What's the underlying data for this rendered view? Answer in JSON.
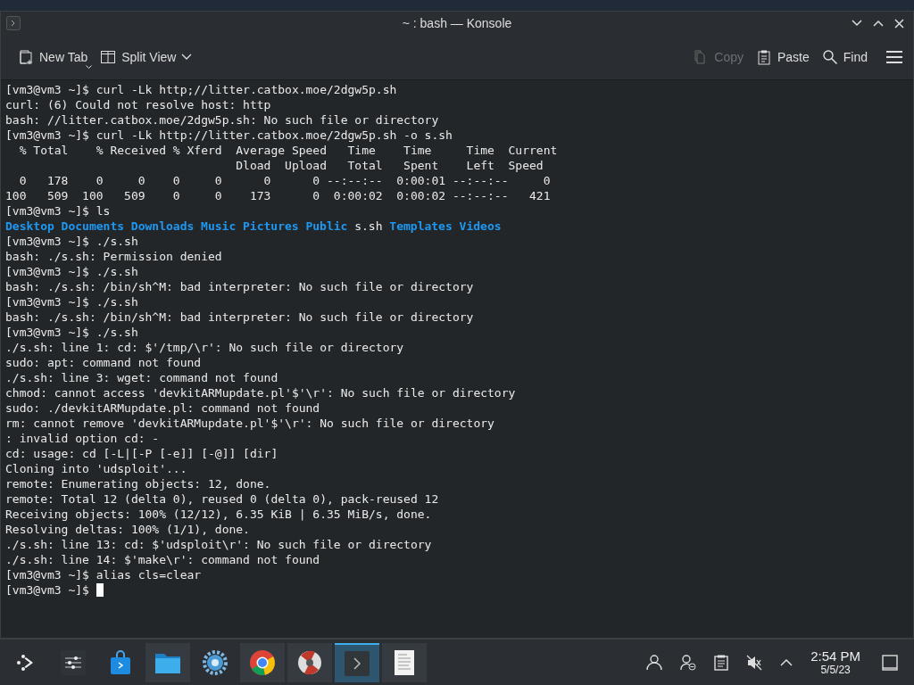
{
  "window": {
    "title": "~ : bash — Konsole"
  },
  "toolbar": {
    "left": [
      {
        "kind": "new-tab",
        "label": "New Tab",
        "disabled": false
      },
      {
        "kind": "split-view",
        "label": "Split View",
        "disabled": false
      }
    ],
    "right": [
      {
        "kind": "copy",
        "label": "Copy",
        "disabled": true
      },
      {
        "kind": "paste",
        "label": "Paste",
        "disabled": false
      },
      {
        "kind": "find",
        "label": "Find",
        "disabled": false
      }
    ]
  },
  "terminal": {
    "lines": [
      {
        "kind": "text",
        "text": "[vm3@vm3 ~]$ curl -Lk http;//litter.catbox.moe/2dgw5p.sh"
      },
      {
        "kind": "text",
        "text": "curl: (6) Could not resolve host: http"
      },
      {
        "kind": "text",
        "text": "bash: //litter.catbox.moe/2dgw5p.sh: No such file or directory"
      },
      {
        "kind": "text",
        "text": "[vm3@vm3 ~]$ curl -Lk http://litter.catbox.moe/2dgw5p.sh -o s.sh"
      },
      {
        "kind": "text",
        "text": "  % Total    % Received % Xferd  Average Speed   Time    Time     Time  Current"
      },
      {
        "kind": "text",
        "text": "                                 Dload  Upload   Total   Spent    Left  Speed"
      },
      {
        "kind": "text",
        "text": "  0   178    0     0    0     0      0      0 --:--:--  0:00:01 --:--:--     0"
      },
      {
        "kind": "text",
        "text": "100   509  100   509    0     0    173      0  0:00:02  0:00:02 --:--:--   421"
      },
      {
        "kind": "text",
        "text": "[vm3@vm3 ~]$ ls"
      },
      {
        "kind": "listing",
        "entries": [
          {
            "name": "Desktop",
            "directory": true
          },
          {
            "name": "Documents",
            "directory": true
          },
          {
            "name": "Downloads",
            "directory": true
          },
          {
            "name": "Music",
            "directory": true
          },
          {
            "name": "Pictures",
            "directory": true
          },
          {
            "name": "Public",
            "directory": true
          },
          {
            "name": "s.sh",
            "directory": false
          },
          {
            "name": "Templates",
            "directory": true
          },
          {
            "name": "Videos",
            "directory": true
          }
        ]
      },
      {
        "kind": "text",
        "text": "[vm3@vm3 ~]$ ./s.sh"
      },
      {
        "kind": "text",
        "text": "bash: ./s.sh: Permission denied"
      },
      {
        "kind": "text",
        "text": "[vm3@vm3 ~]$ ./s.sh"
      },
      {
        "kind": "text",
        "text": "bash: ./s.sh: /bin/sh^M: bad interpreter: No such file or directory"
      },
      {
        "kind": "text",
        "text": "[vm3@vm3 ~]$ ./s.sh"
      },
      {
        "kind": "text",
        "text": "bash: ./s.sh: /bin/sh^M: bad interpreter: No such file or directory"
      },
      {
        "kind": "text",
        "text": "[vm3@vm3 ~]$ ./s.sh"
      },
      {
        "kind": "text",
        "text": "./s.sh: line 1: cd: $'/tmp/\\r': No such file or directory"
      },
      {
        "kind": "text",
        "text": "sudo: apt: command not found"
      },
      {
        "kind": "text",
        "text": "./s.sh: line 3: wget: command not found"
      },
      {
        "kind": "text",
        "text": "chmod: cannot access 'devkitARMupdate.pl'$'\\r': No such file or directory"
      },
      {
        "kind": "text",
        "text": "sudo: ./devkitARMupdate.pl: command not found"
      },
      {
        "kind": "text",
        "text": "rm: cannot remove 'devkitARMupdate.pl'$'\\r': No such file or directory"
      },
      {
        "kind": "text",
        "text": ": invalid option cd: -"
      },
      {
        "kind": "text",
        "text": "cd: usage: cd [-L|[-P [-e]] [-@]] [dir]"
      },
      {
        "kind": "text",
        "text": "Cloning into 'udsploit'..."
      },
      {
        "kind": "text",
        "text": "remote: Enumerating objects: 12, done."
      },
      {
        "kind": "text",
        "text": "remote: Total 12 (delta 0), reused 0 (delta 0), pack-reused 12"
      },
      {
        "kind": "text",
        "text": "Receiving objects: 100% (12/12), 6.35 KiB | 6.35 MiB/s, done."
      },
      {
        "kind": "text",
        "text": "Resolving deltas: 100% (1/1), done."
      },
      {
        "kind": "text",
        "text": "./s.sh: line 13: cd: $'udsploit\\r': No such file or directory"
      },
      {
        "kind": "text",
        "text": "./s.sh: line 14: $'make\\r': command not found"
      },
      {
        "kind": "text",
        "text": "[vm3@vm3 ~]$ alias cls=clear"
      },
      {
        "kind": "prompt",
        "text": "[vm3@vm3 ~]$ "
      }
    ]
  },
  "taskbar": {
    "apps": [
      {
        "kind": "launcher",
        "running": false,
        "active": false
      },
      {
        "kind": "sliders",
        "running": false,
        "active": false
      },
      {
        "kind": "store",
        "running": false,
        "active": false
      },
      {
        "kind": "folder",
        "running": true,
        "active": false
      },
      {
        "kind": "gear",
        "running": false,
        "active": false
      },
      {
        "kind": "browser",
        "running": true,
        "active": false
      },
      {
        "kind": "disc",
        "running": true,
        "active": false
      },
      {
        "kind": "terminal",
        "running": true,
        "active": true
      },
      {
        "kind": "document",
        "running": true,
        "active": false
      }
    ],
    "tray": [
      {
        "kind": "person"
      },
      {
        "kind": "person-minus"
      },
      {
        "kind": "clipboard"
      },
      {
        "kind": "muted"
      },
      {
        "kind": "caret"
      }
    ],
    "clock": {
      "time": "2:54 PM",
      "date": "5/5/23"
    }
  }
}
